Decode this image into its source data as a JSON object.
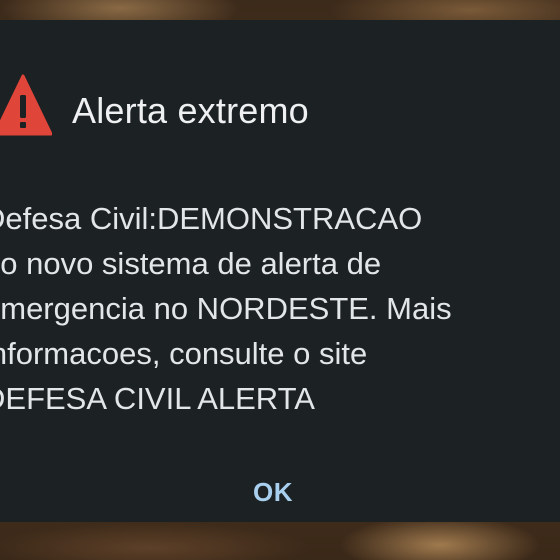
{
  "alert": {
    "icon": "warning-icon",
    "title": "Alerta extremo",
    "message": "Defesa Civil:DEMONSTRACAO\ndo novo sistema de alerta de\nemergencia no NORDESTE. Mais\ninformacoes, consulte o site\nDEFESA CIVIL ALERTA",
    "ok_label": "OK"
  },
  "colors": {
    "dialog_background": "#1c2124",
    "warning_icon": "#e0453a",
    "button_text": "#a8cfee",
    "title_text": "#eef0f1"
  }
}
